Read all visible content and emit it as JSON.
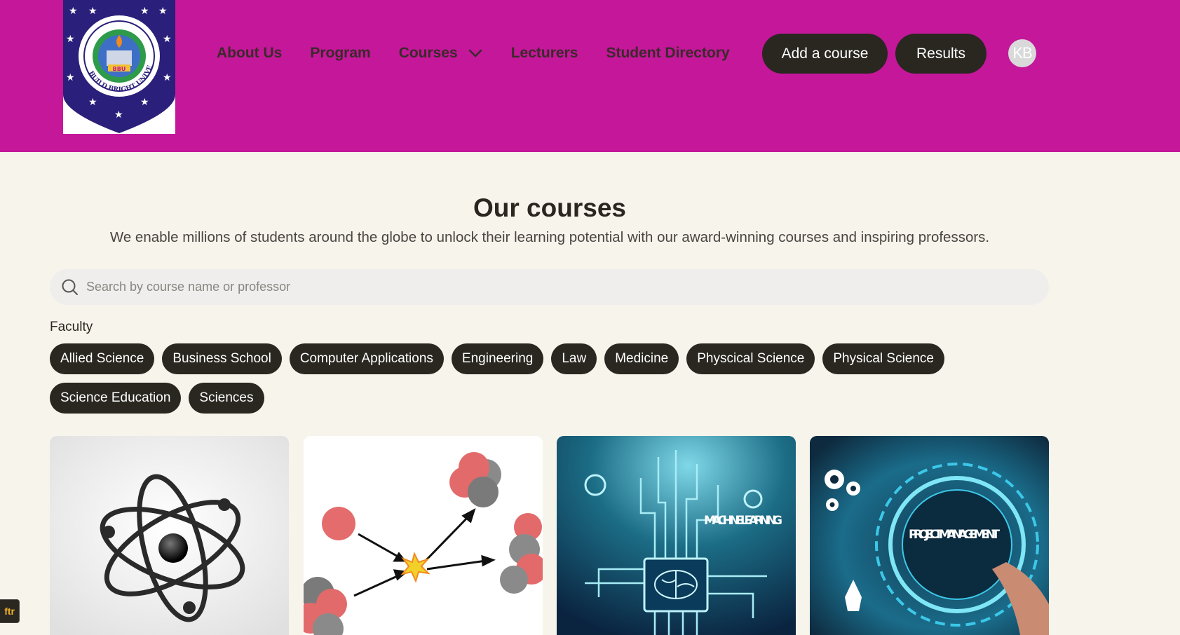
{
  "header": {
    "logo": {
      "alt": "Build Bright University",
      "text_arc": "BUILD BRIGHT UNIVERSITY",
      "monogram": "BBU",
      "colors": {
        "shield": "#2a1f7a",
        "ring": "#ffffff",
        "accent": "#f2c230"
      }
    },
    "nav": [
      {
        "label": "About Us"
      },
      {
        "label": "Program"
      },
      {
        "label": "Courses",
        "icon": "chevron-down-icon"
      },
      {
        "label": "Lecturers"
      },
      {
        "label": "Student Directory"
      }
    ],
    "add_course_label": "Add a course",
    "results_label": "Results",
    "avatar_initials": "KB",
    "background_color": "#c4179a"
  },
  "main": {
    "title": "Our courses",
    "subtitle": "We enable millions of students around the globe to unlock their learning potential with our award-winning courses and inspiring professors.",
    "search": {
      "placeholder": "Search by course name or professor",
      "value": "",
      "icon": "search-icon"
    },
    "faculty_label": "Faculty",
    "faculties": [
      "Allied Science",
      "Business School",
      "Computer Applications",
      "Engineering",
      "Law",
      "Medicine",
      "Physcical Science",
      "Physical Science",
      "Science Education",
      "Sciences"
    ],
    "cards": [
      {
        "image": "atom-illustration"
      },
      {
        "image": "molecule-collision-illustration"
      },
      {
        "image": "machine-learning-chip",
        "image_text": "MACHINE LEARNING"
      },
      {
        "image": "project-management-gears",
        "image_text": "PROJECT MANAGEMENT"
      }
    ]
  },
  "floating_tag": {
    "text": "ftr"
  },
  "colors": {
    "page_bg": "#f7f4ec",
    "dark": "#2a2721",
    "accent": "#c4179a"
  }
}
